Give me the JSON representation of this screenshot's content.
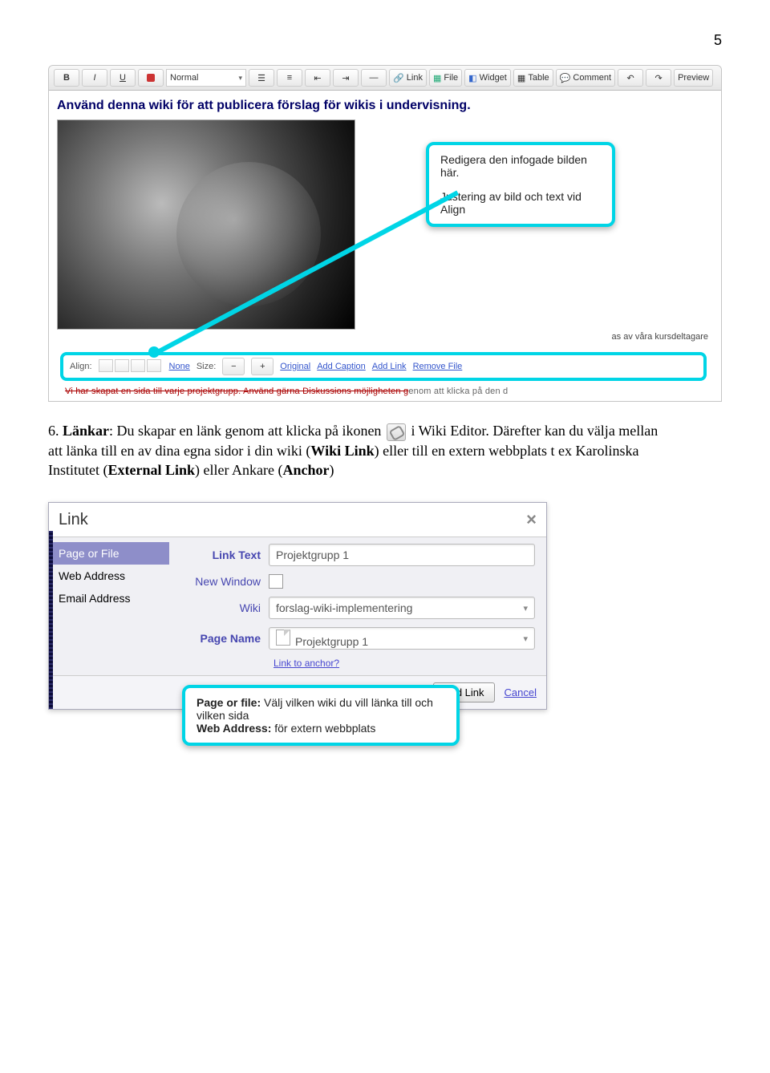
{
  "page_number": "5",
  "editor": {
    "toolbar": {
      "bold": "B",
      "italic": "I",
      "underline": "U",
      "style_select": "Normal",
      "link": "Link",
      "file": "File",
      "widget": "Widget",
      "table": "Table",
      "comment": "Comment",
      "preview": "Preview"
    },
    "heading": "Använd denna wiki för att publicera förslag för wikis i undervisning.",
    "callout1_line1": "Redigera den infogade bilden här.",
    "callout1_line2": "Justering av bild och text vid Align",
    "side_text_a": "as av våra kursdeltagare",
    "obscured_text": "enom att klicka på den d",
    "image_toolbar": {
      "align_label": "Align:",
      "none": "None",
      "size_label": "Size:",
      "minus": "−",
      "plus": "+",
      "original": "Original",
      "add_caption": "Add Caption",
      "add_link": "Add Link",
      "remove_file": "Remove File"
    }
  },
  "body_text": {
    "num": "6.",
    "label": "Länkar",
    "part1": ": Du skapar en länk genom att klicka på ikonen ",
    "part2": " i Wiki Editor. Därefter kan du välja mellan att länka till en av dina egna sidor i din wiki (",
    "wikilink": "Wiki Link",
    "part3": ") eller till en extern webbplats t ex Karolinska Institutet (",
    "extlink": "External Link",
    "part4": ") eller Ankare (",
    "anchor": "Anchor",
    "part5": ")"
  },
  "dialog": {
    "title": "Link",
    "sidebar": {
      "page_or_file": "Page or File",
      "web_address": "Web Address",
      "email_address": "Email Address"
    },
    "labels": {
      "link_text": "Link Text",
      "new_window": "New Window",
      "wiki": "Wiki",
      "page_name": "Page Name"
    },
    "values": {
      "link_text": "Projektgrupp 1",
      "wiki": "forslag-wiki-implementering",
      "page_name": "Projektgrupp 1"
    },
    "anchor_link": "Link to anchor?",
    "callout2_l1a": "Page or file:",
    "callout2_l1b": " Välj vilken wiki du vill länka till och vilken sida",
    "callout2_l2a": "Web Address:",
    "callout2_l2b": " för extern webbplats",
    "footer": {
      "add_link": "Add Link",
      "cancel": "Cancel"
    }
  }
}
